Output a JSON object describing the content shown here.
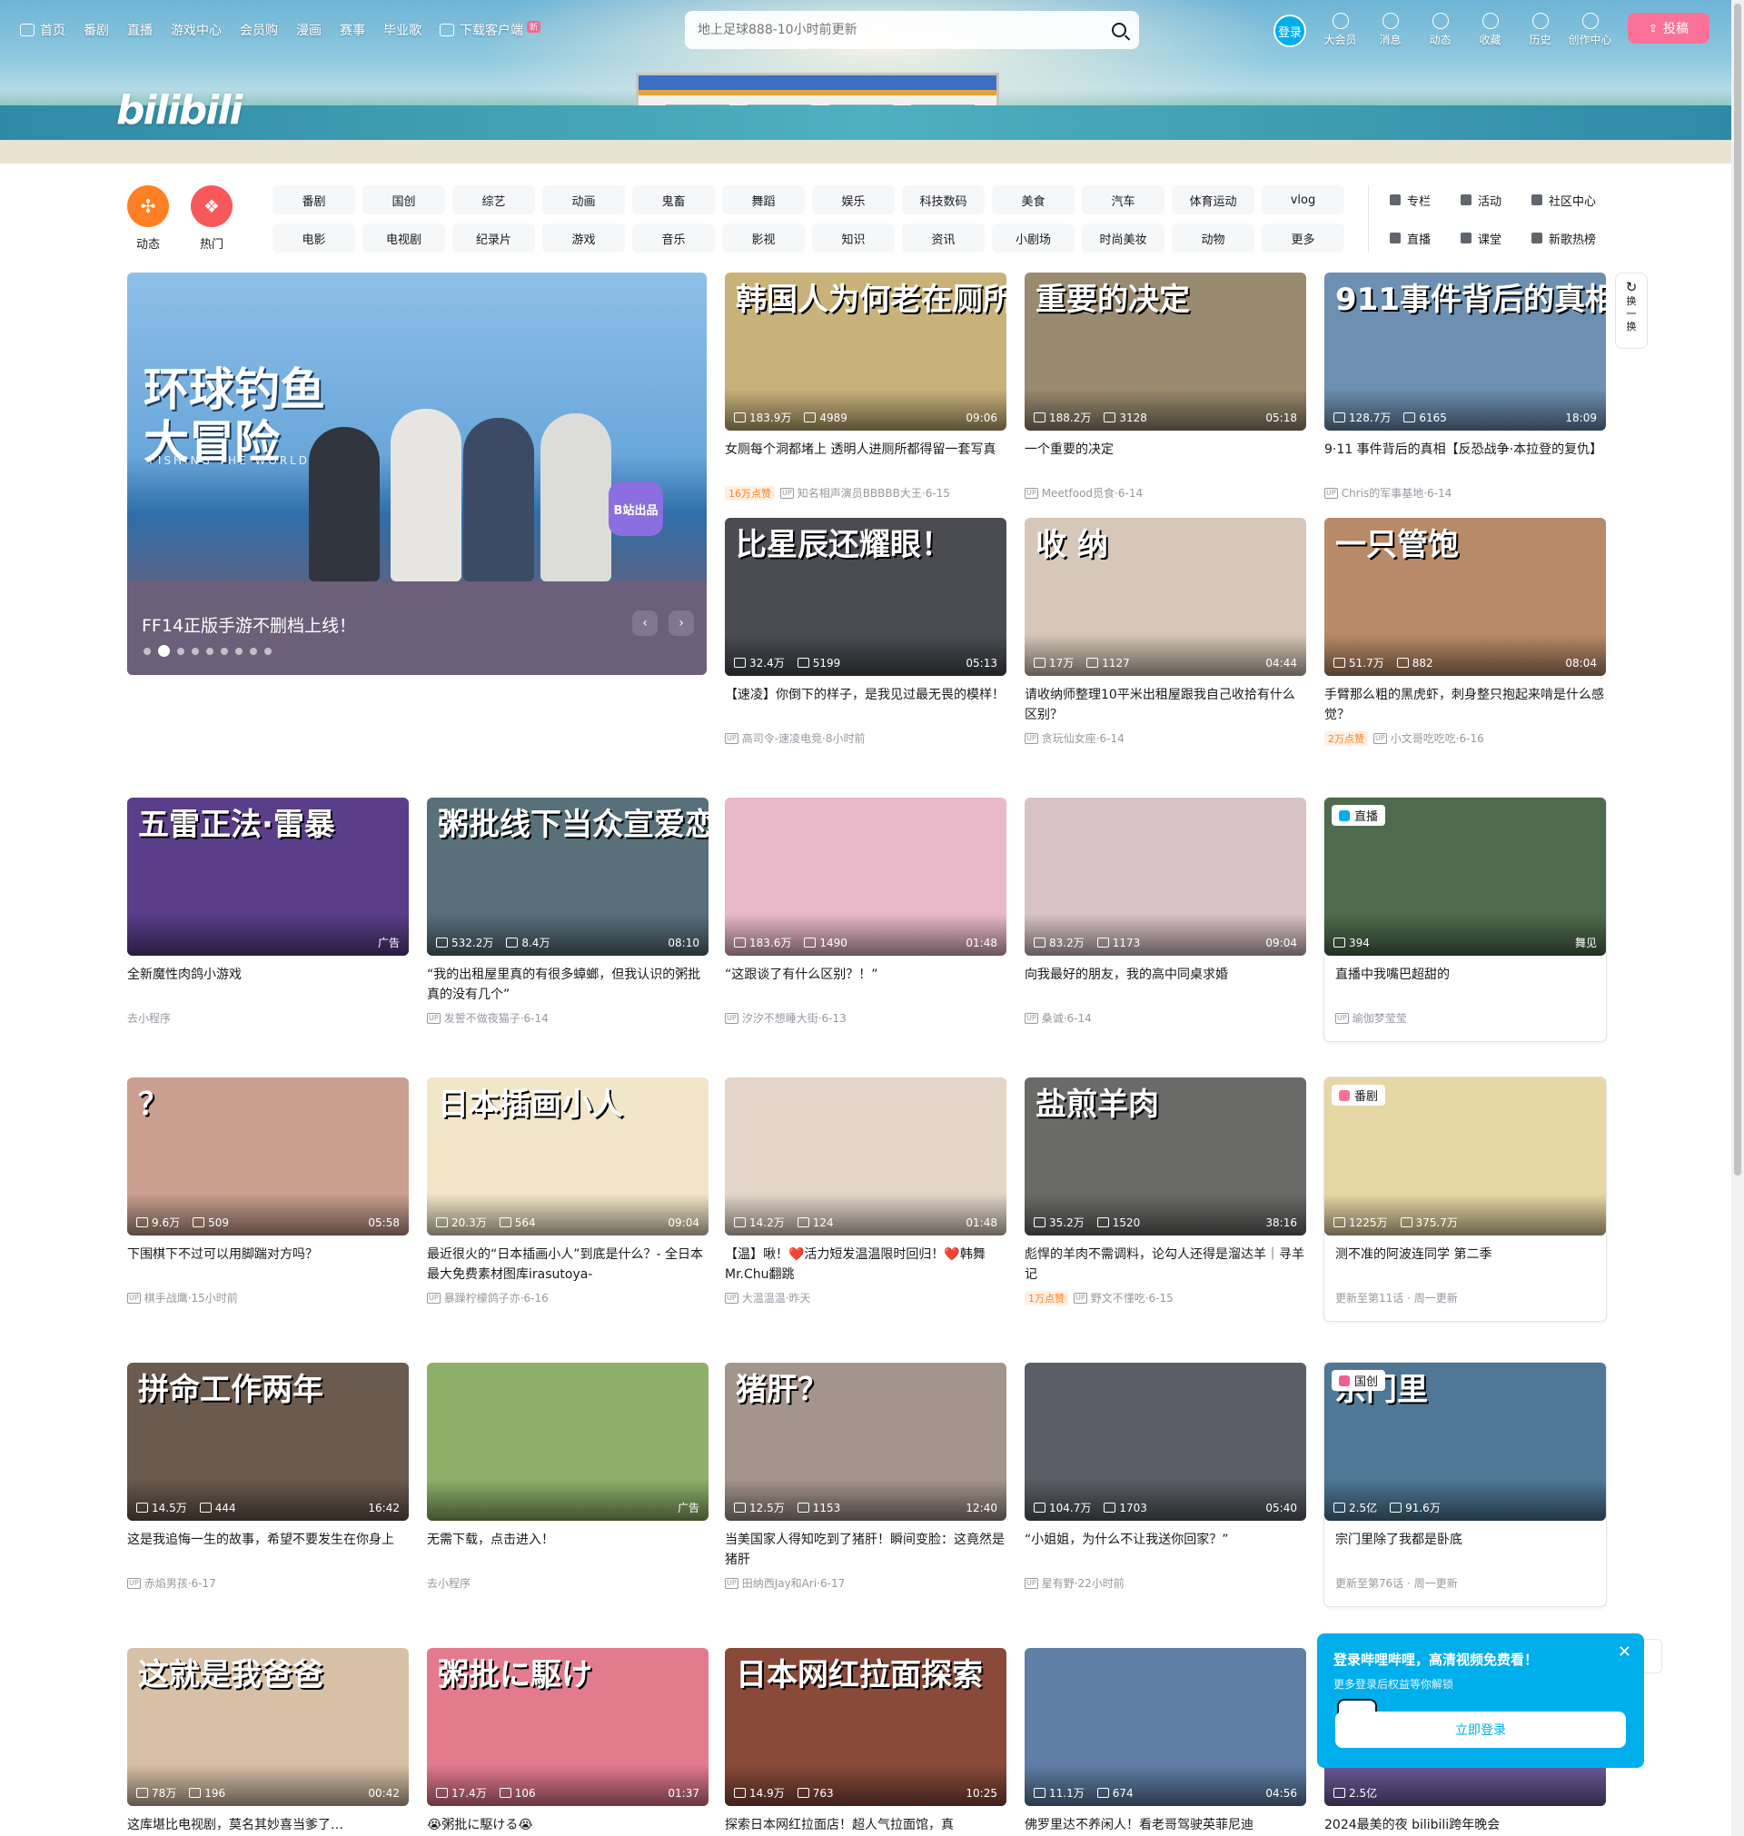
{
  "header": {
    "logo_text": "bilibili",
    "nav": [
      {
        "label": "首页"
      },
      {
        "label": "番剧"
      },
      {
        "label": "直播"
      },
      {
        "label": "游戏中心"
      },
      {
        "label": "会员购"
      },
      {
        "label": "漫画"
      },
      {
        "label": "赛事"
      },
      {
        "label": "毕业歌"
      },
      {
        "label": "下载客户端"
      }
    ],
    "new_badge": "新",
    "search_placeholder": "地上足球888-10小时前更新",
    "login_label": "登录",
    "right_nav": [
      {
        "label": "大会员",
        "icon": "vip-icon"
      },
      {
        "label": "消息",
        "icon": "message-icon"
      },
      {
        "label": "动态",
        "icon": "dynamic-icon"
      },
      {
        "label": "收藏",
        "icon": "favorite-icon"
      },
      {
        "label": "历史",
        "icon": "history-icon"
      },
      {
        "label": "创作中心",
        "icon": "creator-icon"
      }
    ],
    "upload_label": "投稿"
  },
  "channels": {
    "round": [
      {
        "label": "动态",
        "color": "#ff7f24"
      },
      {
        "label": "热门",
        "color": "#f9585b"
      }
    ],
    "grid": [
      "番剧",
      "国创",
      "综艺",
      "动画",
      "鬼畜",
      "舞蹈",
      "娱乐",
      "科技数码",
      "美食",
      "汽车",
      "体育运动",
      "vlog",
      "电影",
      "电视剧",
      "纪录片",
      "游戏",
      "音乐",
      "影视",
      "知识",
      "资讯",
      "小剧场",
      "时尚美妆",
      "动物",
      "更多"
    ],
    "links": [
      "专栏",
      "活动",
      "社区中心",
      "直播",
      "课堂",
      "新歌热榜"
    ]
  },
  "carousel": {
    "caption": "FF14正版手游不删档上线！",
    "art_title": "环球钓鱼大冒险",
    "art_sub": "FISHING THE WORLD",
    "badge": "B站出品",
    "dot_count": 9,
    "active_dot": 1
  },
  "refresh": {
    "label1": "换",
    "label2": "一",
    "label3": "换"
  },
  "cards": [
    {
      "art": "韩国人为何老在厕所偷拍",
      "bg": "#c9b27a",
      "views": "183.9万",
      "danmaku": "4989",
      "dur": "09:06",
      "title": "女厕每个洞都堵上 透明人进厕所都得留一套写真",
      "hot": "16万点赞",
      "up": "知名相声演员BBBBB大王",
      "date": "6-15"
    },
    {
      "art": "重要的决定",
      "bg": "#9a8a70",
      "views": "188.2万",
      "danmaku": "3128",
      "dur": "05:18",
      "title": "一个重要的决定",
      "hot": "",
      "up": "Meetfood觅食",
      "date": "6-14"
    },
    {
      "art": "911事件背后的真相",
      "bg": "#6d8fb0",
      "views": "128.7万",
      "danmaku": "6165",
      "dur": "18:09",
      "title": "9·11 事件背后的真相【反恐战争·本拉登的复仇】",
      "hot": "",
      "up": "Chris的军事基地",
      "date": "6-14"
    },
    {
      "art": "比星辰还耀眼！",
      "bg": "#4a4c52",
      "views": "32.4万",
      "danmaku": "5199",
      "dur": "05:13",
      "title": "【速凌】你倒下的样子，是我见过最无畏的模样！",
      "hot": "",
      "up": "高司令-速凌电竞",
      "date": "8小时前"
    },
    {
      "art": "收  纳",
      "bg": "#d6c7b8",
      "views": "17万",
      "danmaku": "1127",
      "dur": "04:44",
      "title": "请收纳师整理10平米出租屋跟我自己收拾有什么区别？",
      "hot": "",
      "up": "贪玩仙女座",
      "date": "6-14"
    },
    {
      "art": "一只管饱",
      "bg": "#b88a68",
      "views": "51.7万",
      "danmaku": "882",
      "dur": "08:04",
      "title": "手臂那么粗的黑虎虾，刺身整只抱起来啃是什么感觉？",
      "hot": "2万点赞",
      "up": "小文哥吃吃吃",
      "date": "6-16"
    },
    {
      "art": "五雷正法·雷暴",
      "bg": "#5a3e8a",
      "views": "",
      "danmaku": "",
      "dur": "广告",
      "title": "全新魔性肉鸽小游戏",
      "hot": "",
      "up": "去小程序",
      "date": "",
      "ad": true
    },
    {
      "art": "粥批线下当众宣爱恋",
      "bg": "#57707a",
      "views": "532.2万",
      "danmaku": "8.4万",
      "dur": "08:10",
      "title": "“我的出租屋里真的有很多蟑螂，但我认识的粥批真的没有几个”",
      "hot": "",
      "up": "发誓不做夜猫子",
      "date": "6-14"
    },
    {
      "art": "",
      "bg": "#e8b9c8",
      "views": "183.6万",
      "danmaku": "1490",
      "dur": "01:48",
      "title": "“这跟谈了有什么区别？！”",
      "hot": "",
      "up": "汐汐不想睡大街",
      "date": "6-13"
    },
    {
      "art": "",
      "bg": "#d9c2c6",
      "views": "83.2万",
      "danmaku": "1173",
      "dur": "09:04",
      "title": "向我最好的朋友，我的高中同桌求婚",
      "hot": "",
      "up": "桑诚",
      "date": "6-14"
    },
    {
      "art": "",
      "bg": "#4e6b4e",
      "views": "394",
      "danmaku": "",
      "dur": "舞见",
      "title": "我嘴巴超甜的",
      "hot": "",
      "up": "瑜伽梦莹莹",
      "date": "",
      "live": "直播中",
      "tag": "直播",
      "tagcolor": "#00aeec",
      "boxed": true
    },
    {
      "art": "？",
      "bg": "#c99f8f",
      "views": "9.6万",
      "danmaku": "509",
      "dur": "05:58",
      "title": "下围棋下不过可以用脚踹对方吗？",
      "hot": "",
      "up": "棋手战鹰",
      "date": "15小时前"
    },
    {
      "art": "日本插画小人",
      "bg": "#f1e6c8",
      "views": "20.3万",
      "danmaku": "564",
      "dur": "09:04",
      "title": "最近很火的“日本插画小人”到底是什么？- 全日本最大免费素材图库irasutoya-",
      "hot": "",
      "up": "暴躁柠檬鸽子亦",
      "date": "6-16"
    },
    {
      "art": "",
      "bg": "#e3d6c9",
      "views": "14.2万",
      "danmaku": "124",
      "dur": "01:48",
      "title": "【温】啾！❤️活力短发温温限时回归！❤️韩舞Mr.Chu翻跳",
      "hot": "",
      "up": "大温温温",
      "date": "昨天"
    },
    {
      "art": "盐煎羊肉",
      "bg": "#6a6a68",
      "views": "35.2万",
      "danmaku": "1520",
      "dur": "38:16",
      "title": "彪悍的羊肉不需调料，论勾人还得是溜达羊｜寻羊记",
      "hot": "1万点赞",
      "up": "野文不懂吃",
      "date": "6-15"
    },
    {
      "art": "",
      "bg": "#e7d7a4",
      "views": "1225万",
      "danmaku": "375.7万",
      "dur": "",
      "title": "测不准的阿波连同学 第二季",
      "hot": "",
      "up": "更新至第11话 · 周一更新",
      "date": "",
      "tag": "番剧",
      "tagcolor": "#fb7299",
      "boxed": true,
      "noup": true
    },
    {
      "art": "拼命工作两年",
      "bg": "#6b5a4e",
      "views": "14.5万",
      "danmaku": "444",
      "dur": "16:42",
      "title": "这是我追悔一生的故事，希望不要发生在你身上",
      "hot": "",
      "up": "赤焰男孩",
      "date": "6-17"
    },
    {
      "art": "",
      "bg": "#8fb06a",
      "views": "",
      "danmaku": "",
      "dur": "广告",
      "title": "无需下载，点击进入！",
      "hot": "",
      "up": "去小程序",
      "date": "",
      "ad": true
    },
    {
      "art": "猪肝？",
      "bg": "#a4958c",
      "views": "12.5万",
      "danmaku": "1153",
      "dur": "12:40",
      "title": "当美国家人得知吃到了猪肝！瞬间变脸：这竟然是猪肝",
      "hot": "",
      "up": "田纳西Jay和Ari",
      "date": "6-17"
    },
    {
      "art": "",
      "bg": "#5b5e66",
      "views": "104.7万",
      "danmaku": "1703",
      "dur": "05:40",
      "title": "“小姐姐，为什么不让我送你回家？”",
      "hot": "",
      "up": "星有野",
      "date": "22小时前"
    },
    {
      "art": "宗门里",
      "bg": "#4f7896",
      "views": "2.5亿",
      "danmaku": "91.6万",
      "dur": "",
      "title": "宗门里除了我都是卧底",
      "hot": "",
      "up": "更新至第76话 · 周一更新",
      "date": "",
      "tag": "国创",
      "tagcolor": "#f25d8e",
      "boxed": true,
      "noup": true
    },
    {
      "art": "这就是我爸爸",
      "bg": "#d8c0a6",
      "views": "78万",
      "danmaku": "196",
      "dur": "00:42",
      "title": "这库堪比电视剧，莫名其妙喜当爹了…",
      "hot": "",
      "up": "",
      "date": ""
    },
    {
      "art": "粥批に駆け",
      "bg": "#e47a8e",
      "views": "17.4万",
      "danmaku": "106",
      "dur": "01:37",
      "title": "😭粥批に駆ける😭",
      "hot": "",
      "up": "",
      "date": ""
    },
    {
      "art": "日本网红拉面探索",
      "bg": "#8a4a3a",
      "views": "14.9万",
      "danmaku": "763",
      "dur": "10:25",
      "title": "探索日本网红拉面店！超人气拉面馆，真",
      "hot": "",
      "up": "",
      "date": ""
    },
    {
      "art": "",
      "bg": "#5f7fa6",
      "views": "11.1万",
      "danmaku": "674",
      "dur": "04:56",
      "title": "佛罗里达不养闲人！看老哥驾驶英菲尼迪",
      "hot": "",
      "up": "",
      "date": ""
    },
    {
      "art": "",
      "bg": "#6d5a9a",
      "views": "2.5亿",
      "danmaku": "",
      "dur": "",
      "title": "2024最美的夜 bilibili跨年晚会",
      "hot": "",
      "up": "",
      "date": ""
    }
  ],
  "popup": {
    "title": "登录哔哩哔哩，高清视频免费看！",
    "subtitle": "更多登录后权益等你解锁",
    "button": "立即登录"
  }
}
